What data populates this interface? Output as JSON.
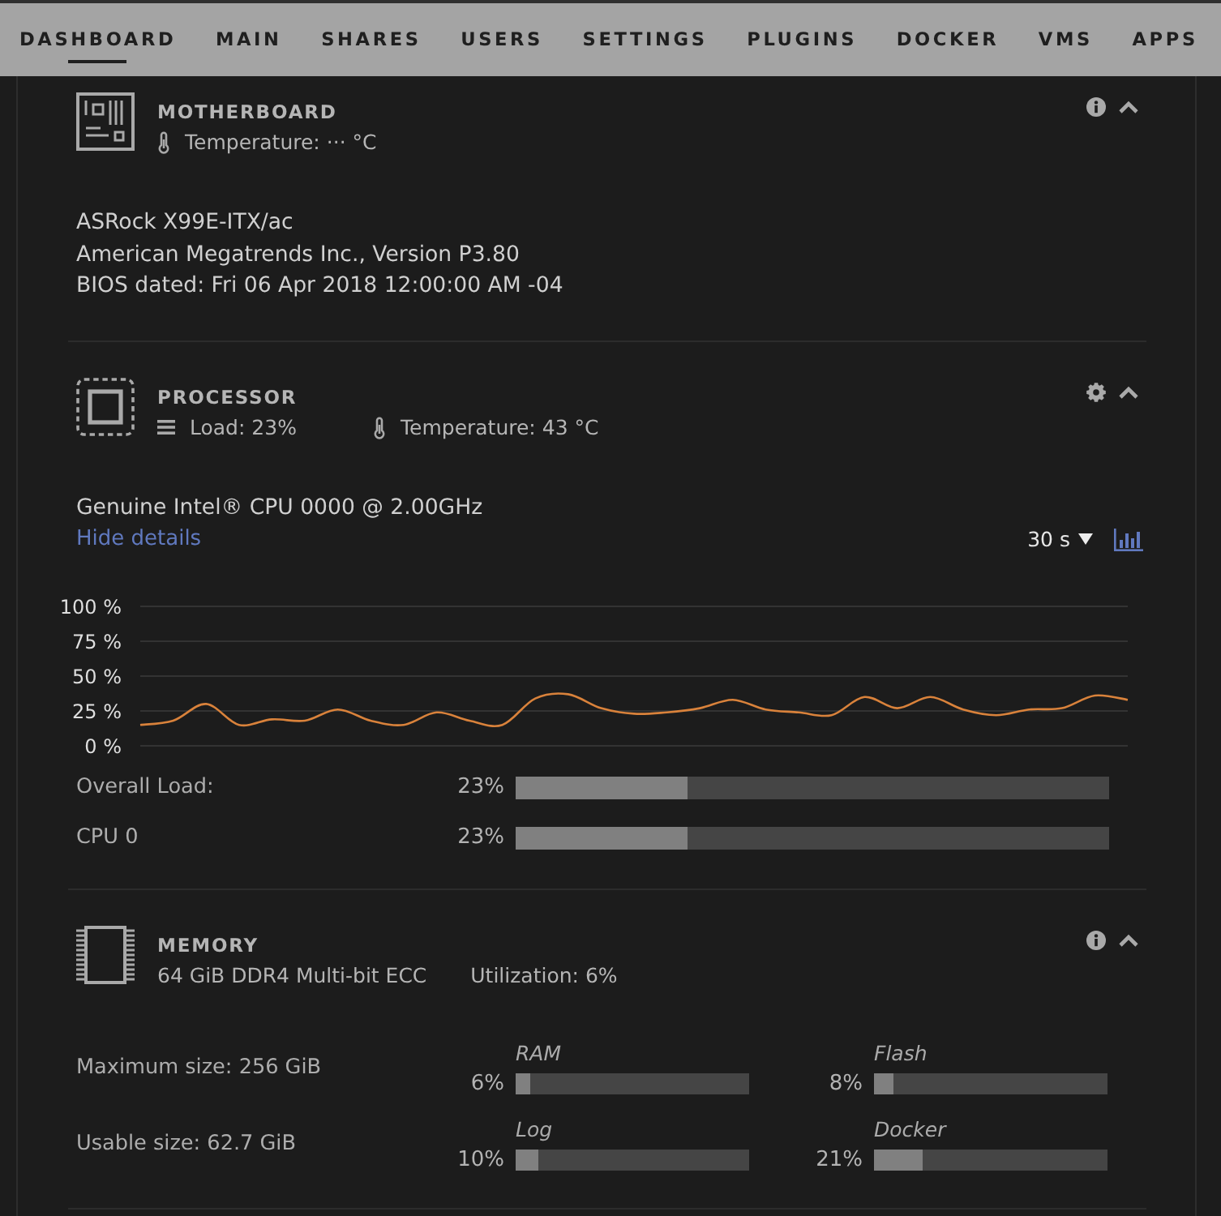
{
  "nav": {
    "tabs": [
      {
        "label": "DASHBOARD",
        "selected": true
      },
      {
        "label": "MAIN",
        "selected": false
      },
      {
        "label": "SHARES",
        "selected": false
      },
      {
        "label": "USERS",
        "selected": false
      },
      {
        "label": "SETTINGS",
        "selected": false
      },
      {
        "label": "PLUGINS",
        "selected": false
      },
      {
        "label": "DOCKER",
        "selected": false
      },
      {
        "label": "VMS",
        "selected": false
      },
      {
        "label": "APPS",
        "selected": false
      }
    ]
  },
  "panels": [
    {
      "kind": "motherboard",
      "title": "MOTHERBOARD",
      "expanded": true,
      "stats": [
        {
          "kind": "temperature",
          "text": "Temperature: ··· °C"
        }
      ],
      "details": [
        "ASRock X99E-ITX/ac",
        "American Megatrends Inc., Version P3.80",
        "BIOS dated: Fri 06 Apr 2018 12:00:00 AM -04"
      ]
    },
    {
      "kind": "processor",
      "title": "PROCESSOR",
      "expanded": true,
      "stats": [
        {
          "kind": "load",
          "text": "Load: 23%"
        },
        {
          "kind": "temperature",
          "text": "Temperature: 43 °C"
        }
      ],
      "details": [
        "Genuine Intel® CPU 0000 @ 2.00GHz"
      ],
      "link": "Hide details",
      "interval": "30 s",
      "chart_data": {
        "type": "line",
        "grid": true,
        "ylim": [
          0,
          100
        ],
        "yticks": [
          {
            "value": 100,
            "label": "100 %"
          },
          {
            "value": 75,
            "label": "75 %"
          },
          {
            "value": 50,
            "label": "50 %"
          },
          {
            "value": 25,
            "label": "25 %"
          },
          {
            "value": 0,
            "label": "0 %"
          }
        ],
        "series": [
          {
            "color": "#d9823b",
            "values": [
              15,
              18,
              30,
              15,
              19,
              18,
              26,
              18,
              15,
              24,
              18,
              15,
              34,
              37,
              27,
              23,
              24,
              27,
              33,
              26,
              24,
              22,
              35,
              27,
              35,
              26,
              22,
              26,
              27,
              36,
              33
            ]
          }
        ]
      },
      "meters": [
        {
          "label": "Overall Load:",
          "reading": "23%",
          "level": 0.29
        },
        {
          "label": "CPU 0",
          "reading": "23%",
          "level": 0.29
        }
      ]
    },
    {
      "kind": "memory",
      "title": "MEMORY",
      "expanded": true,
      "stats": [
        {
          "kind": "text",
          "text": "64 GiB DDR4 Multi-bit ECC"
        },
        {
          "kind": "text",
          "text": "Utilization: 6%"
        }
      ],
      "rows": [
        {
          "label": "Maximum size: 256 GiB",
          "meters": [
            {
              "name": "RAM",
              "reading": "6%",
              "level": 0.06
            },
            {
              "name": "Flash",
              "reading": "8%",
              "level": 0.08
            }
          ]
        },
        {
          "label": "Usable size: 62.7 GiB",
          "meters": [
            {
              "name": "Log",
              "reading": "10%",
              "level": 0.1
            },
            {
              "name": "Docker",
              "reading": "21%",
              "level": 0.21
            }
          ]
        }
      ]
    }
  ]
}
